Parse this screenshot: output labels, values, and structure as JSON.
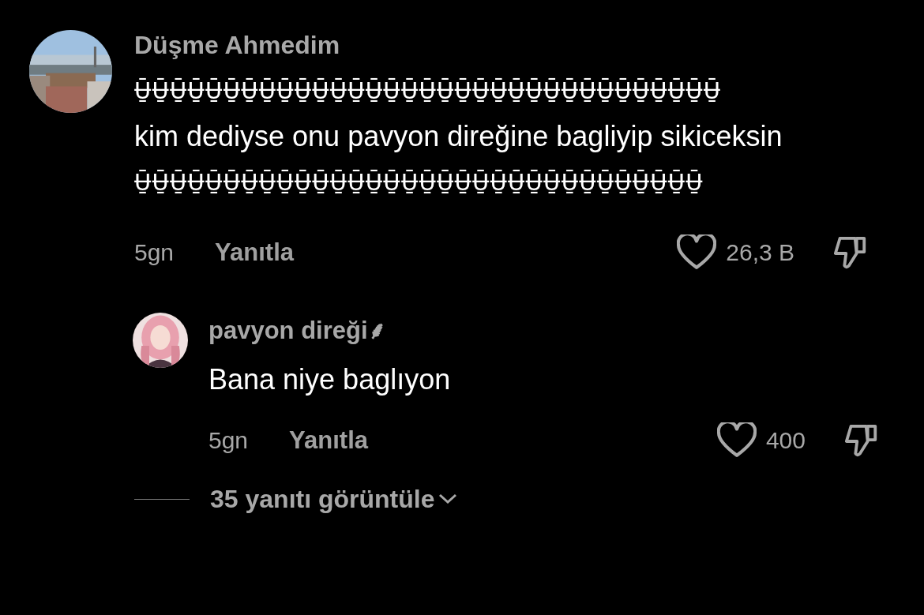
{
  "comment": {
    "author": "Düşme Ahmedim",
    "body": [
      "Ʉ̱̄Ʉ̱̄Ʉ̱̄Ʉ̱̄Ʉ̱̄Ʉ̱̄Ʉ̱̄Ʉ̱̄Ʉ̱̄Ʉ̱̄Ʉ̱̄Ʉ̱̄Ʉ̱̄Ʉ̱̄Ʉ̱̄Ʉ̱̄Ʉ̱̄Ʉ̱̄Ʉ̱̄Ʉ̱̄Ʉ̱̄Ʉ̱̄Ʉ̱̄Ʉ̱̄Ʉ̱̄Ʉ̱̄Ʉ̱̄Ʉ̱̄Ʉ̱̄Ʉ̱̄Ʉ̱̄Ʉ̱̄Ʉ̱̄",
      "kim dediyse onu pavyon direğine bagliyip sikiceksin",
      "Ʉ̱̄Ʉ̱̄Ʉ̱̄Ʉ̱̄Ʉ̱̄Ʉ̱̄Ʉ̱̄Ʉ̱̄Ʉ̱̄Ʉ̱̄Ʉ̱̄Ʉ̱̄Ʉ̱̄Ʉ̱̄Ʉ̱̄Ʉ̱̄Ʉ̱̄Ʉ̱̄Ʉ̱̄Ʉ̱̄Ʉ̱̄Ʉ̱̄Ʉ̱̄Ʉ̱̄Ʉ̱̄Ʉ̱̄Ʉ̱̄Ʉ̱̄Ʉ̱̄Ʉ̱̄Ʉ̱̄Ʉ̱̄"
    ],
    "time": "5gn",
    "reply_label": "Yanıtla",
    "likes": "26,3 B",
    "liked": false
  },
  "reply": {
    "author": "pavyon direği⸙",
    "body": [
      "Bana niye baglıyon"
    ],
    "time": "5gn",
    "reply_label": "Yanıtla",
    "likes": "400",
    "liked": false
  },
  "view_replies": "35 yanıtı görüntüle"
}
